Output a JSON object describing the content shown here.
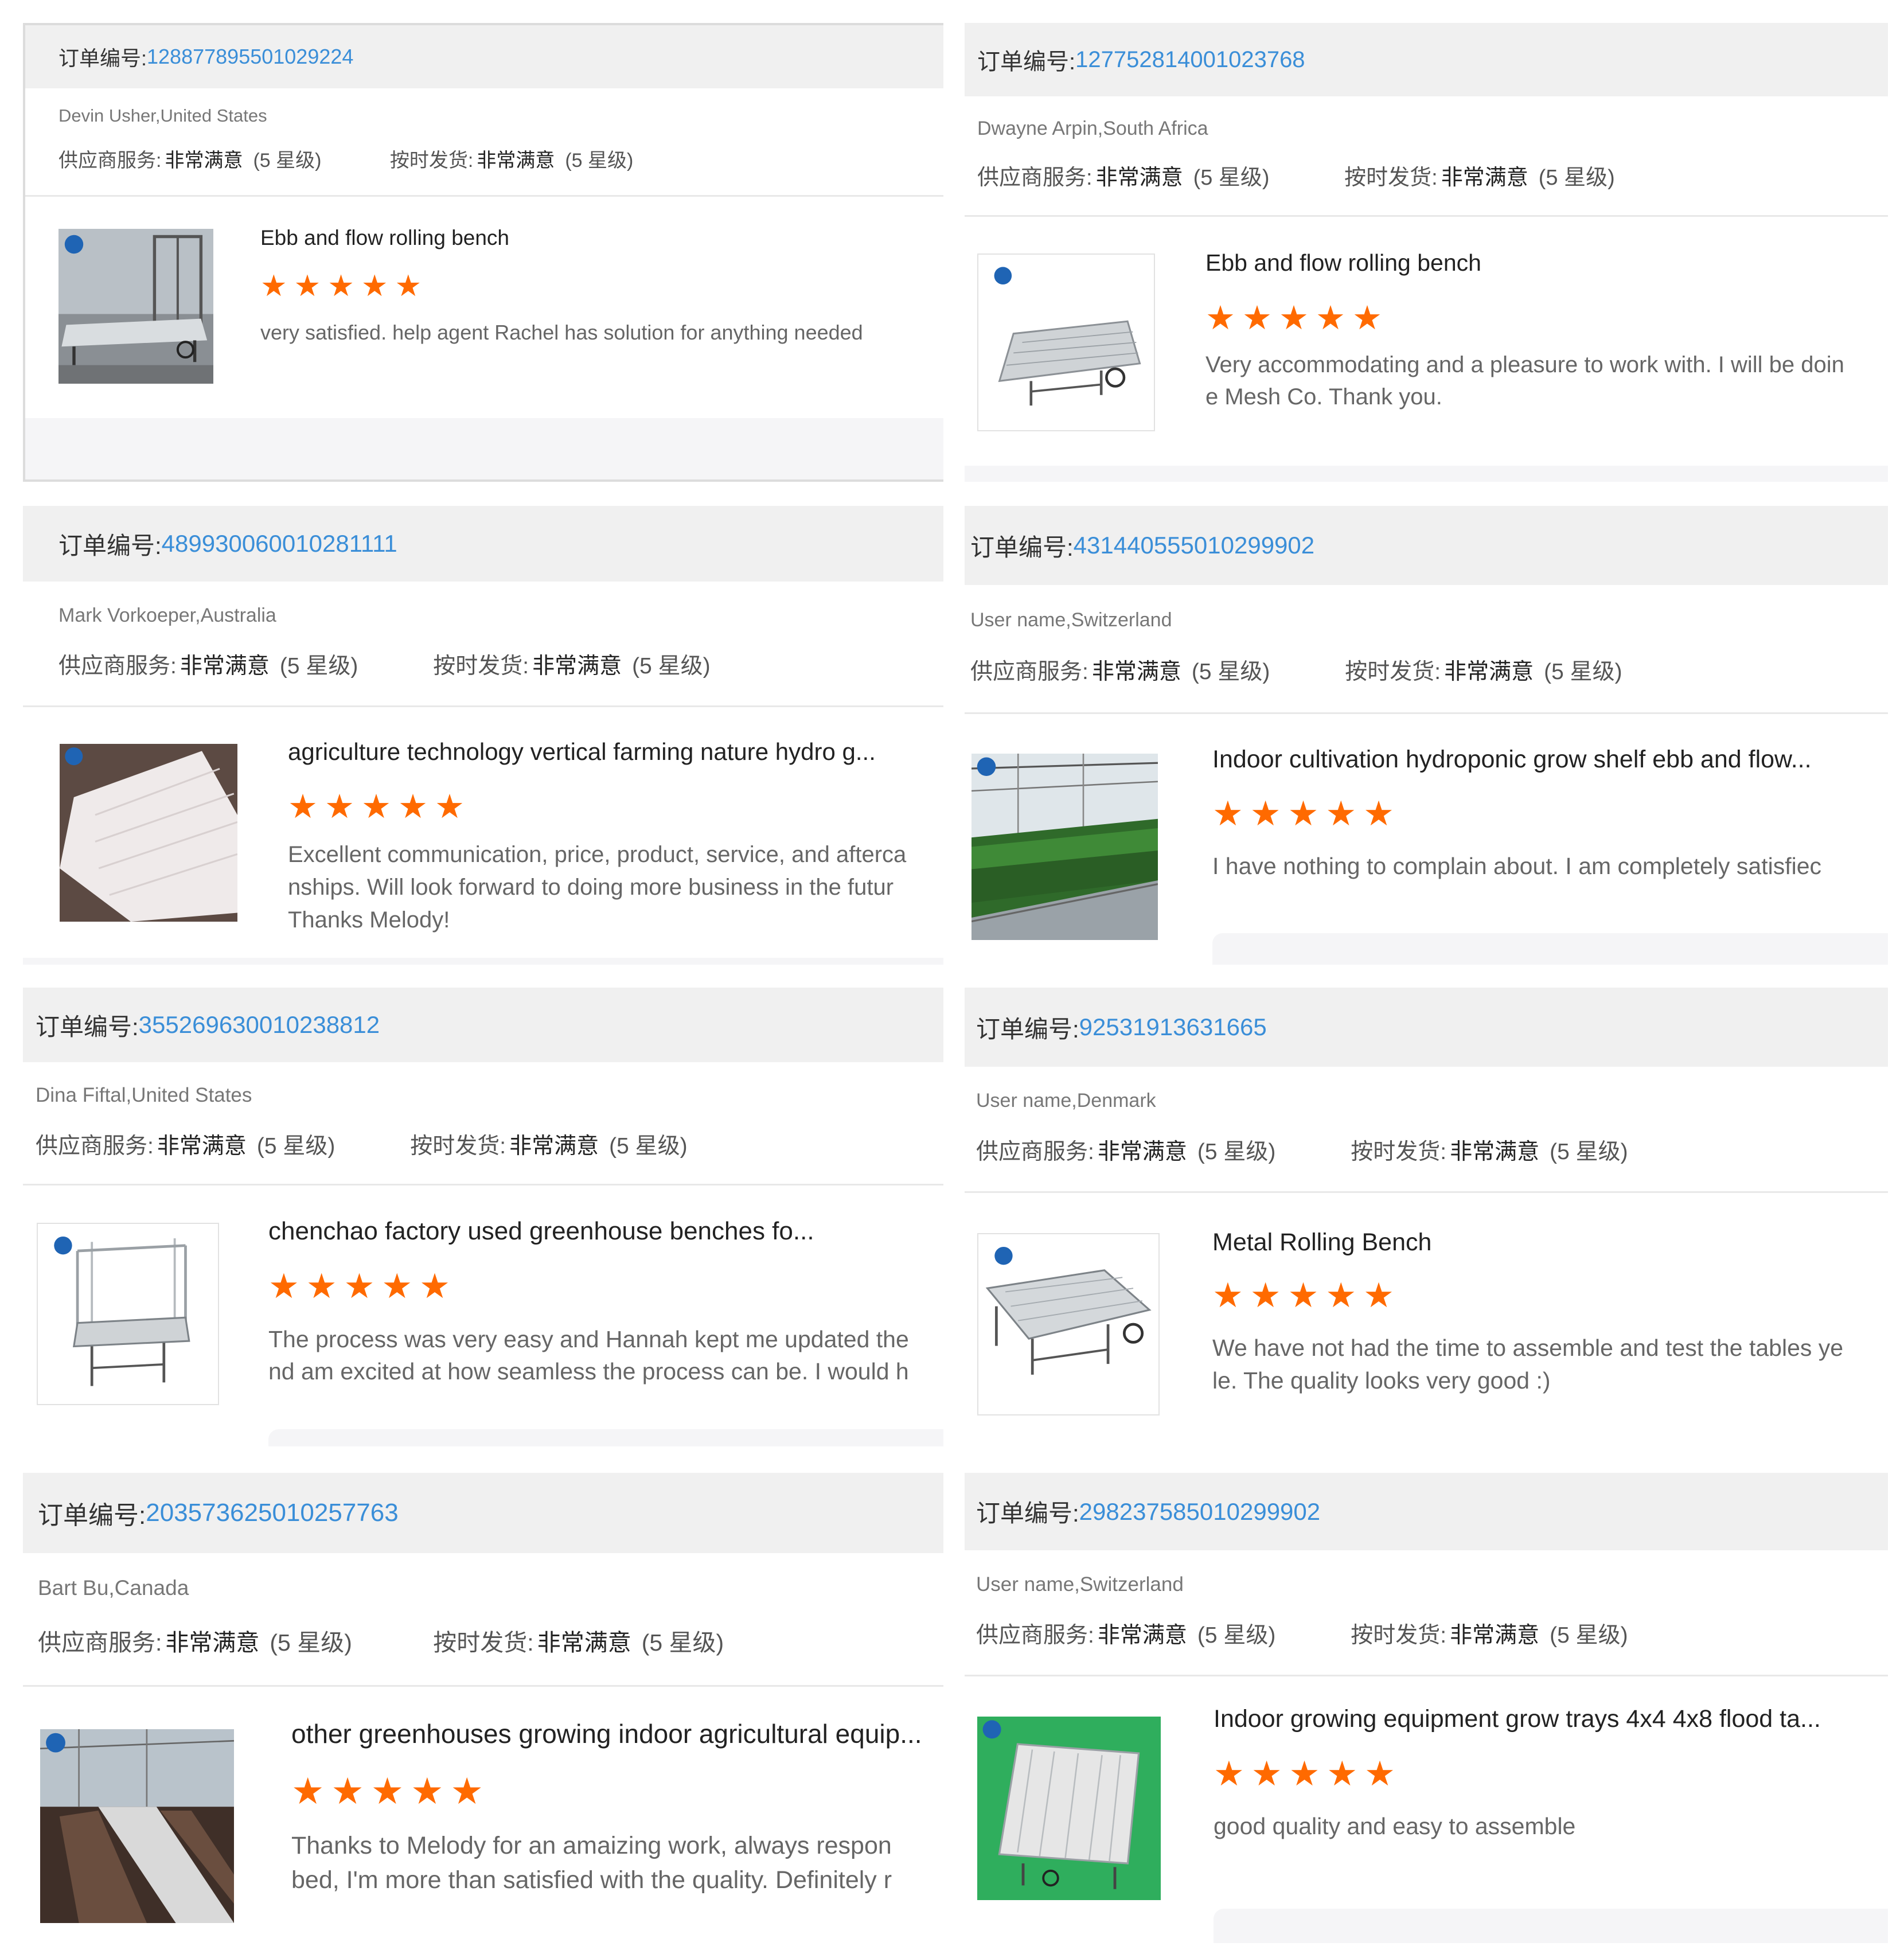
{
  "order_label": "订单编号:",
  "supplier_service_label": "供应商服务:",
  "ontime_label": "按时发货:",
  "rating_value": "非常满意",
  "rating_level": "(5 星级)",
  "star_glyphs": "★★★★★",
  "star_color": "#ff6a00",
  "link_color": "#3a8ed8",
  "reviews": [
    {
      "order_no": "128877895501029224",
      "buyer": "Devin Usher,United States",
      "product": "Ebb and flow rolling bench",
      "stars": 5,
      "comment": [
        "very satisfied. help agent Rachel has solution for anything needed"
      ],
      "thumb_icon": "rolling-bench-photo"
    },
    {
      "order_no": "127752814001023768",
      "buyer": "Dwayne Arpin,South Africa",
      "product": "Ebb and flow rolling bench",
      "stars": 5,
      "comment": [
        "Very accommodating and a pleasure to work with. I will be doin",
        "e Mesh Co. Thank you."
      ],
      "thumb_icon": "rolling-bench-product"
    },
    {
      "order_no": "489930060010281111",
      "buyer": "Mark Vorkoeper,Australia",
      "product": "agriculture technology vertical farming nature hydro g...",
      "stars": 5,
      "comment": [
        "Excellent communication, price, product, service, and afterca",
        "nships. Will look forward to doing more business in the futur",
        "Thanks Melody!"
      ],
      "thumb_icon": "white-tray-photo"
    },
    {
      "order_no": "431440555010299902",
      "buyer": "User name,Switzerland",
      "product": "Indoor cultivation hydroponic grow shelf ebb and flow...",
      "stars": 5,
      "comment": [
        "I have nothing to complain about. I am completely satisfiec"
      ],
      "thumb_icon": "greenhouse-seedlings-photo"
    },
    {
      "order_no": "355269630010238812",
      "buyer": "Dina Fiftal,United States",
      "product": "chenchao factory used greenhouse benches fo...",
      "stars": 5,
      "comment": [
        "The process was very easy and Hannah kept me updated the",
        "nd am excited at how seamless the process can be. I would h"
      ],
      "thumb_icon": "bench-frame-product"
    },
    {
      "order_no": "92531913631665",
      "buyer": "User name,Denmark",
      "product": "Metal Rolling Bench",
      "stars": 5,
      "comment": [
        "We have not had the time to assemble and test the tables ye",
        "le. The quality looks very good :)"
      ],
      "thumb_icon": "metal-rolling-bench-product"
    },
    {
      "order_no": "203573625010257763",
      "buyer": "Bart Bu,Canada",
      "product": "other greenhouses growing indoor agricultural equip...",
      "stars": 5,
      "comment": [
        "Thanks to Melody for an amaizing work, always respon",
        "bed, I'm more than satisfied with the quality. Definitely r"
      ],
      "thumb_icon": "greenhouse-benches-photo"
    },
    {
      "order_no": "298237585010299902",
      "buyer": "User name,Switzerland",
      "product": "Indoor growing equipment grow trays 4x4 4x8 flood ta...",
      "stars": 5,
      "comment": [
        "good quality and easy to assemble"
      ],
      "thumb_icon": "flood-tray-product"
    }
  ]
}
